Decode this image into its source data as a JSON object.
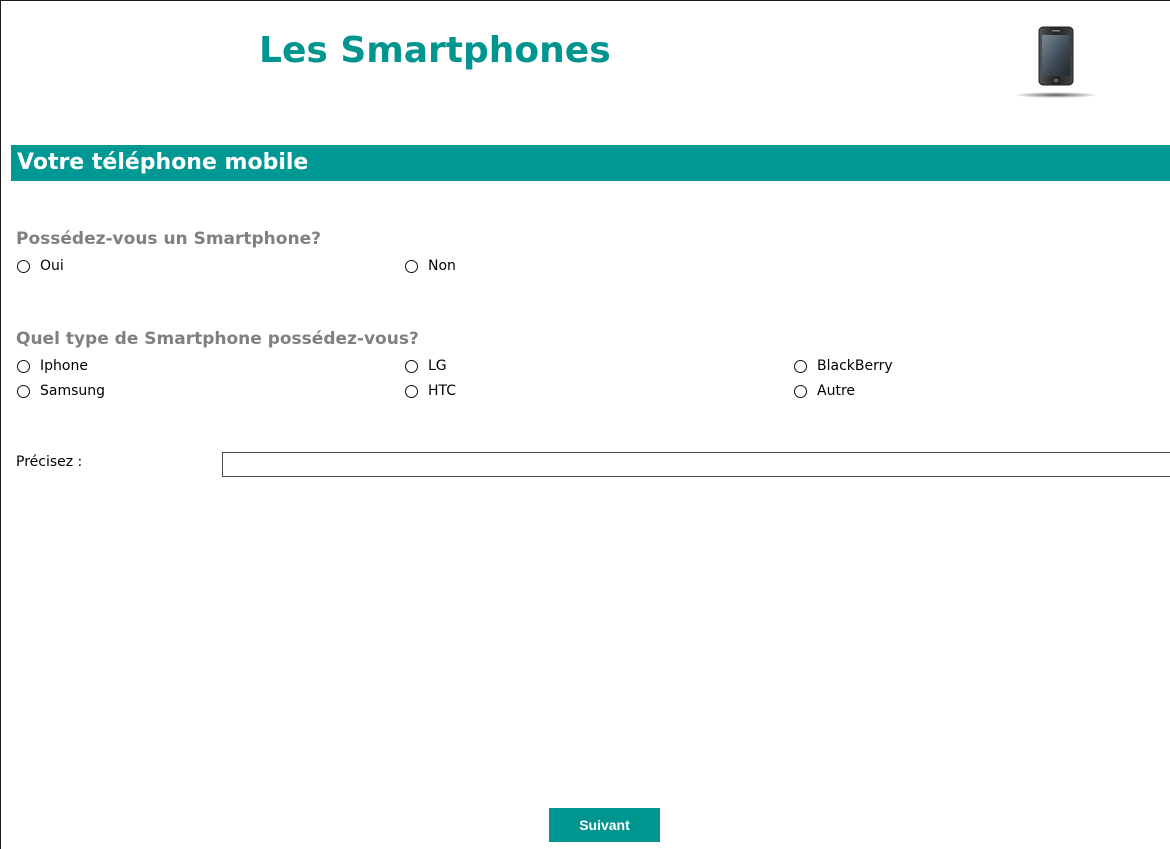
{
  "header": {
    "title": "Les Smartphones",
    "logo_icon": "smartphone-icon"
  },
  "section": {
    "title": "Votre téléphone mobile"
  },
  "q1": {
    "label": "Possédez-vous un Smartphone?",
    "options": [
      "Oui",
      "Non"
    ],
    "selected": null
  },
  "q2": {
    "label": "Quel type de Smartphone possédez-vous?",
    "options": [
      "Iphone",
      "LG",
      "BlackBerry",
      "Samsung",
      "HTC",
      "Autre"
    ],
    "selected": null
  },
  "precisez": {
    "label": "Précisez :",
    "value": ""
  },
  "footer": {
    "next_label": "Suivant"
  },
  "colors": {
    "accent": "#00958f",
    "question_text": "#808080"
  }
}
